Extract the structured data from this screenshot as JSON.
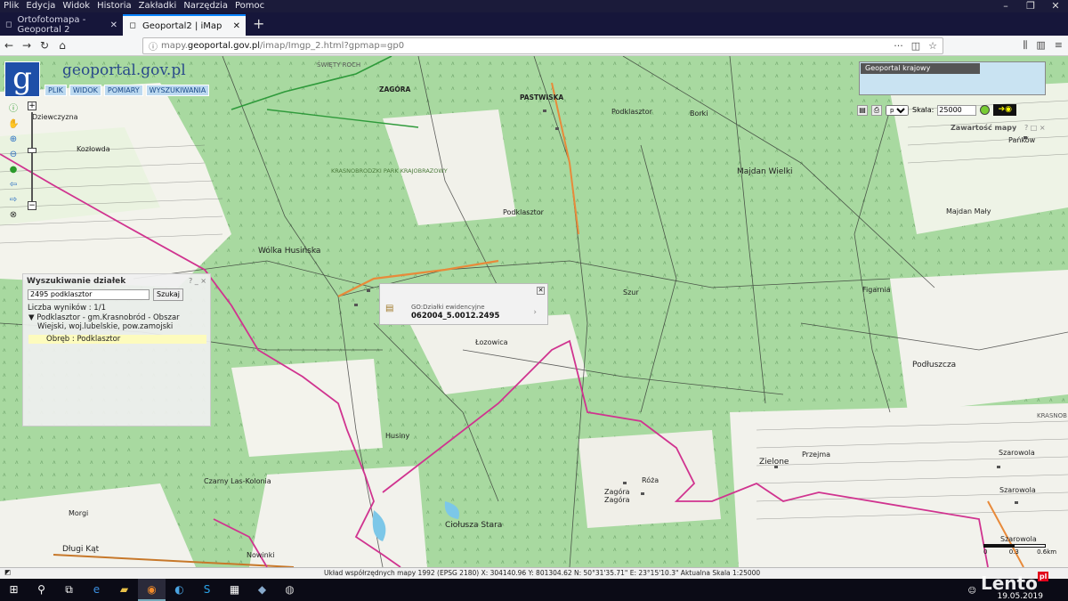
{
  "menubar": [
    "Plik",
    "Edycja",
    "Widok",
    "Historia",
    "Zakładki",
    "Narzędzia",
    "Pomoc"
  ],
  "tabs": [
    {
      "label": "Ortofotomapa - Geoportal 2"
    },
    {
      "label": "Geoportal2 | iMap"
    }
  ],
  "address": {
    "prefix": "mapy.",
    "domain": "geoportal.gov.pl",
    "path": "/imap/Imgp_2.html?gpmap=gp0"
  },
  "app": {
    "logo_letter": "g",
    "logo_text": "geoportal.gov.pl",
    "menu": [
      "PLIK",
      "WIDOK",
      "POMIARY",
      "WYSZUKIWANIA"
    ]
  },
  "map": {
    "places": [
      {
        "name": "ŚWIĘTY ROCH"
      },
      {
        "name": "ZAGÓRA"
      },
      {
        "name": "PASTWISKA"
      },
      {
        "name": "Podklasztor"
      },
      {
        "name": "Borki"
      },
      {
        "name": "Pańków"
      },
      {
        "name": "Kozłowda"
      },
      {
        "name": "Majdan Wielki"
      },
      {
        "name": "KRASNOBRODZKI PARK KRAJOBRAZOWY"
      },
      {
        "name": "Podklasztor"
      },
      {
        "name": "Majdan Mały"
      },
      {
        "name": "Wólka Husińska"
      },
      {
        "name": "Szur"
      },
      {
        "name": "Figarnia"
      },
      {
        "name": "Łozowica"
      },
      {
        "name": "Podłuszcza"
      },
      {
        "name": "Husiny"
      },
      {
        "name": "KRASNOB"
      },
      {
        "name": "Przejma"
      },
      {
        "name": "Zielone"
      },
      {
        "name": "Szarowola"
      },
      {
        "name": "Róża"
      },
      {
        "name": "Zagóra"
      },
      {
        "name": "Zagóra"
      },
      {
        "name": "Czarny Las-Kolonia"
      },
      {
        "name": "Szarowola"
      },
      {
        "name": "Morgi"
      },
      {
        "name": "Ciołusza Stara"
      },
      {
        "name": "Szarowola"
      },
      {
        "name": "Długi Kąt"
      },
      {
        "name": "Nowinki"
      },
      {
        "name": "Dziewczyzna"
      }
    ]
  },
  "search_panel": {
    "title": "Wyszukiwanie działek",
    "controls": "? _ ×",
    "input_value": "2495  podklasztor",
    "button_label": "Szukaj",
    "results_count": "Liczba wyników : 1/1",
    "result_line1": "▼ Podklasztor - gm.Krasnobród - Obszar",
    "result_line2": "Wiejski, woj.lubelskie, pow.zamojski",
    "selected": "Obręb : Podklasztor"
  },
  "popup": {
    "layer": "GO:Działki ewidencyjne",
    "parcel_id": "062004_5.0012.2495"
  },
  "overview": {
    "title": "Geoportal krajowy"
  },
  "toolbar": {
    "lang": "pol",
    "scale_label": "Skala:",
    "scale_value": "25000"
  },
  "contents": {
    "title": "Zawartość mapy",
    "controls": "? □ ×"
  },
  "scalebar": {
    "labels": [
      "0",
      "0.3",
      "0.6km"
    ]
  },
  "status": {
    "text": "Układ współrzędnych mapy  1992 (EPSG 2180)    X: 304140.96  Y: 801304.62    N: 50°31'35.71\"  E: 23°15'10.3\"   Aktualna Skala  1:25000"
  },
  "taskbar": {
    "date": "19.05.2019"
  },
  "watermark": {
    "brand": "Lento",
    "suffix": "pl"
  },
  "colors": {
    "map_green": "#9fd49a",
    "boundary": "#d0338f",
    "road": "#222222",
    "accent": "#0a84ff"
  }
}
